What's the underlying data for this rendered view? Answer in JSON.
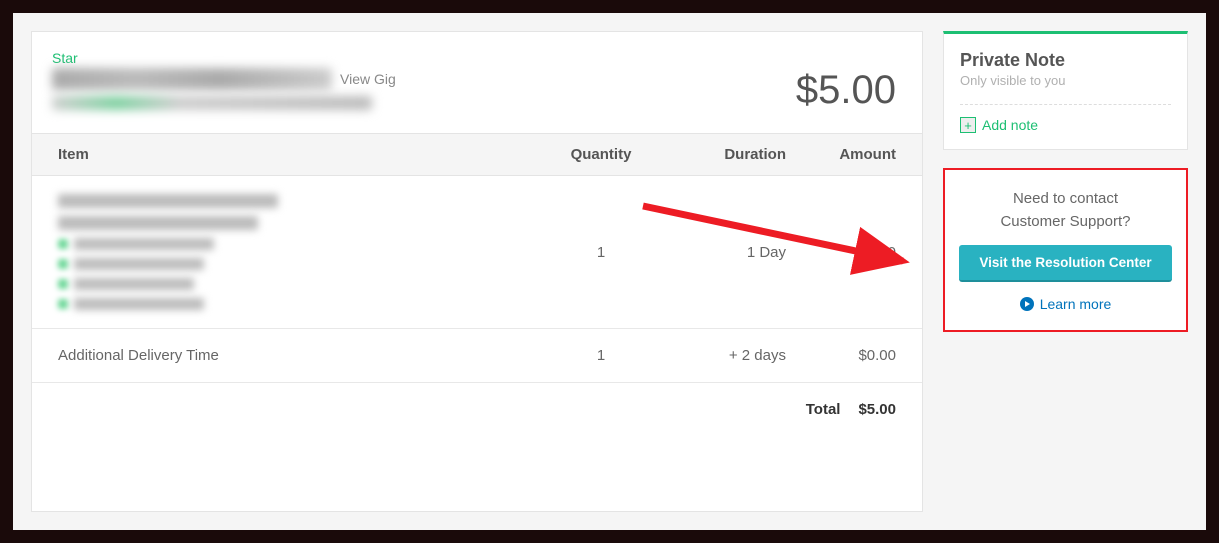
{
  "header": {
    "star_label": "Star",
    "view_gig": "View Gig",
    "price": "$5.00"
  },
  "table": {
    "headers": {
      "item": "Item",
      "quantity": "Quantity",
      "duration": "Duration",
      "amount": "Amount"
    },
    "rows": [
      {
        "quantity": "1",
        "duration": "1 Day",
        "amount": "$5.00"
      },
      {
        "item": "Additional Delivery Time",
        "quantity": "1",
        "duration": "+ 2 days",
        "amount": "$0.00"
      }
    ],
    "total_label": "Total",
    "total_amount": "$5.00"
  },
  "sidebar": {
    "note": {
      "title": "Private Note",
      "subtitle": "Only visible to you",
      "add_label": "Add note"
    },
    "support": {
      "line1": "Need to contact",
      "line2": "Customer Support?",
      "button": "Visit the Resolution Center",
      "learn_more": "Learn more"
    }
  },
  "colors": {
    "accent": "#1dbf73",
    "button": "#29b2c1",
    "annotation": "#ed1c24",
    "link": "#0073bb"
  }
}
